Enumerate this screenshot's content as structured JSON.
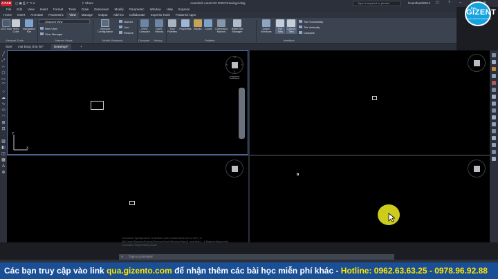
{
  "titlebar": {
    "logo": "A CAD",
    "share": "Share",
    "title": "Autodesk AutoCAD 2023    Drawing4.dwg",
    "search_placeholder": "Type a keyword or phrase",
    "user": "lovanthanh0612"
  },
  "menubar": [
    "File",
    "Edit",
    "View",
    "Insert",
    "Format",
    "Tools",
    "Draw",
    "Dimension",
    "Modify",
    "Parametric",
    "Window",
    "Help",
    "Express"
  ],
  "ribbon_tabs": [
    {
      "label": "Home"
    },
    {
      "label": "Insert"
    },
    {
      "label": "Annotate"
    },
    {
      "label": "Parametric"
    },
    {
      "label": "View",
      "active": true
    },
    {
      "label": "Manage"
    },
    {
      "label": "Output"
    },
    {
      "label": "Add-ins"
    },
    {
      "label": "Collaborate"
    },
    {
      "label": "Express Tools"
    },
    {
      "label": "Featured Apps"
    }
  ],
  "ribbon": {
    "viewport_tools": {
      "ucs_icon": "UCS Icon",
      "view_cube": "View Cube",
      "navigation_bar": "Navigation Bar",
      "panel": "Viewport Tools"
    },
    "named_views": {
      "dropdown": "Unsaved View",
      "new_view": "New View",
      "view_manager": "View Manager",
      "panel": "Named Views"
    },
    "model_viewports": {
      "viewport_configuration": "Viewport Configuration",
      "named": "Named",
      "join": "Join",
      "restore": "Restore",
      "panel": "Model Viewports"
    },
    "compare": {
      "dwg_compare": "DWG Compare",
      "panel": "Compare"
    },
    "history": {
      "dwg_history": "DWG History",
      "panel": "History"
    },
    "palettes": {
      "tool_palettes": "Tool Palettes",
      "properties": "Properties",
      "blocks": "Blocks",
      "count": "Count",
      "command_macros": "Command Macros",
      "sheet_set_manager": "Sheet Set Manager",
      "panel": "Palettes"
    },
    "interface": {
      "switch_windows": "Switch Windows",
      "file_tabs": "File Tabs",
      "layout_tabs": "Layout Tabs",
      "tile_horizontally": "Tile Horizontally",
      "tile_vertically": "Tile Vertically",
      "cascade": "Cascade",
      "panel": "Interface"
    }
  },
  "file_tabs": {
    "start": "Start",
    "tab1": "mat bang chot (5)*",
    "tab2": "Drawing4*",
    "add": "+"
  },
  "viewcube": {
    "n": "N",
    "s": "S",
    "e": "E",
    "w": "W",
    "wcs": "WCS"
  },
  "command": {
    "history": [
      "Command: Specify corner of window, enter a scale factor (nX or nXP), or",
      "[All/Center/Dynamic/Extents/Previous/Scale/Window/Object] <real time>: _e Regenerating model.",
      "Command: Regenerating model."
    ],
    "placeholder": "Type a command",
    "close": "×"
  },
  "banner": {
    "part1": "Các bạn truy cập vào link ",
    "link": "qua.gizento.com",
    "part2": " để nhận thêm các bài học miễn phí khác - ",
    "hotline": "Hotline: 0962.63.63.25 - 0978.96.92.88"
  },
  "logo": {
    "sub": "Edu",
    "name": "GIZENT",
    "tag": "Let's work for your future"
  },
  "colors": {
    "banner_bg": "#1a4f96",
    "banner_highlight": "#ffe600",
    "active_viewport": "#4c73b3",
    "logo_blue": "#15a3e0"
  }
}
